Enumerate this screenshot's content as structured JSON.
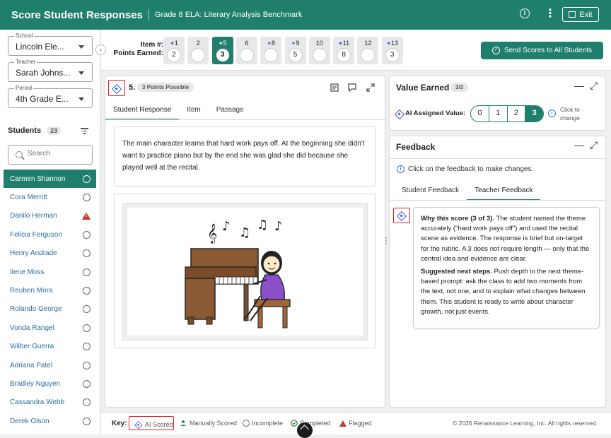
{
  "header": {
    "title": "Score Student Responses",
    "subtitle": "Grade 8 ELA: Literary Analysis Benchmark",
    "info_glyph": "i",
    "menu_glyph": "⋮",
    "exit_label": "Exit"
  },
  "filters": {
    "school": {
      "label": "School",
      "value": "Lincoln Ele..."
    },
    "teacher": {
      "label": "Teacher",
      "value": "Sarah Johns..."
    },
    "period": {
      "label": "Period",
      "value": "4th Grade E..."
    }
  },
  "students": {
    "heading": "Students",
    "count": "23",
    "search_placeholder": "Search",
    "list": [
      {
        "name": "Carmen Shannon",
        "status": "incomplete",
        "active": true
      },
      {
        "name": "Cora Merritt",
        "status": "incomplete"
      },
      {
        "name": "Danilo Herman",
        "status": "flagged"
      },
      {
        "name": "Felicia Ferguson",
        "status": "incomplete"
      },
      {
        "name": "Henry Andrade",
        "status": "incomplete"
      },
      {
        "name": "Ilene Moss",
        "status": "incomplete"
      },
      {
        "name": "Reuben Mora",
        "status": "incomplete"
      },
      {
        "name": "Rolando George",
        "status": "incomplete"
      },
      {
        "name": "Vonda Rangel",
        "status": "incomplete"
      },
      {
        "name": "Wilber Guerra",
        "status": "incomplete"
      },
      {
        "name": "Adriana Patel",
        "status": "incomplete"
      },
      {
        "name": "Bradley Nguyen",
        "status": "incomplete"
      },
      {
        "name": "Cassandra Webb",
        "status": "incomplete"
      },
      {
        "name": "Derek Olson",
        "status": "incomplete"
      }
    ]
  },
  "collapse_glyph": "‹",
  "items": {
    "label_item": "Item #:",
    "label_points": "Points Earned:",
    "list": [
      {
        "num": "1",
        "ai": true,
        "points": "2"
      },
      {
        "num": "2",
        "ai": false,
        "points": ""
      },
      {
        "num": "5",
        "ai": true,
        "points": "3",
        "active": true
      },
      {
        "num": "6",
        "ai": false,
        "points": ""
      },
      {
        "num": "8",
        "ai": true,
        "points": ""
      },
      {
        "num": "9",
        "ai": true,
        "points": "5"
      },
      {
        "num": "10",
        "ai": false,
        "points": ""
      },
      {
        "num": "11",
        "ai": true,
        "points": "8"
      },
      {
        "num": "12",
        "ai": false,
        "points": ""
      },
      {
        "num": "13",
        "ai": true,
        "points": "3"
      }
    ],
    "ai_glyph": "✦",
    "send_label": "Send Scores to All Students",
    "send_glyph": "✓"
  },
  "question": {
    "number": "5.",
    "points_possible": "3 Points Possible",
    "tabs": [
      "Student Response",
      "Item",
      "Passage"
    ],
    "response_text": "The main character learns that hard work pays off. At the beginning she didn't want to practice piano but by the end she was glad she did because she played well at the recital.",
    "music_notes": [
      "𝄞",
      "♪",
      "♫",
      "♫",
      "♪"
    ]
  },
  "value_earned": {
    "title": "Value Earned",
    "fraction": "3/3",
    "ai_label": "AI Assigned Value:",
    "options": [
      "0",
      "1",
      "2",
      "3"
    ],
    "selected": "3",
    "hint_line1": "Click to",
    "hint_line2": "change",
    "info_glyph": "i"
  },
  "feedback": {
    "title": "Feedback",
    "info_text": "Click on the feedback to make changes.",
    "info_glyph": "i",
    "tabs": [
      "Student Feedback",
      "Teacher Feedback"
    ],
    "active_tab": "Teacher Feedback",
    "why_heading": "Why this score (3 of 3).",
    "why_text": " The student named the theme accurately (\"hard work pays off\") and used the recital scene as evidence. The response is brief but on-target for the rubric. A 3 does not require length — only that the central idea and evidence are clear.",
    "next_heading": "Suggested next steps.",
    "next_text": " Push depth in the next theme-based prompt: ask the class to add two moments from the text, not one, and to explain what changes between them. This student is ready to write about character growth, not just events."
  },
  "panel_controls": {
    "minimize": "—",
    "expand": "⤢"
  },
  "footer": {
    "key_label": "Key:",
    "ai_scored": "AI Scored",
    "manually_scored": "Manually Scored",
    "incomplete": "Incomplete",
    "completed": "Completed",
    "flagged": "Flagged",
    "copyright": "© 2026 Renaissance Learning, Inc. All rights reserved."
  },
  "colors": {
    "brand": "#1f7f6c",
    "ai_blue": "#3a5bd4",
    "flag_red": "#c0392b",
    "annotation_red": "#dd2222"
  }
}
